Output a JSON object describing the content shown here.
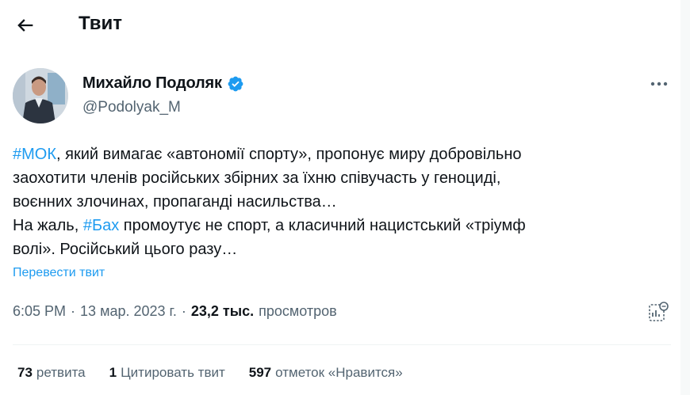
{
  "header": {
    "title": "Твит",
    "back_icon": "arrow-left-icon"
  },
  "author": {
    "name": "Михайло Подоляк",
    "handle": "@Podolyak_M",
    "verified": true,
    "verified_color": "#1d9bf0"
  },
  "tweet": {
    "line1": {
      "tag": "#МОК",
      "text": ", який вимагає «автономії спорту», пропонує миру добровільно"
    },
    "line2": "заохотити членів російських збірних за їхню співучасть у геноциді,",
    "line3": "воєнних злочинах, пропаганді насильства…",
    "line4": {
      "prefix": "На жаль, ",
      "tag": "#Бах",
      "text": " промоутує не спорт, а класичний нацистський «тріумф"
    },
    "line5": "волі». Російський цього разу…"
  },
  "translate_label": "Перевести твит",
  "meta": {
    "time": "6:05 PM",
    "separator": "·",
    "date": "13 мар. 2023 г.",
    "views_count": "23,2 тыс.",
    "views_label": "просмотров"
  },
  "stats": {
    "retweets_count": "73",
    "retweets_label": "ретвита",
    "quotes_count": "1",
    "quotes_label": "Цитировать твит",
    "likes_count": "597",
    "likes_label": "отметок «Нравится»"
  },
  "colors": {
    "accent": "#1d9bf0",
    "secondary_text": "#536471",
    "text": "#0f1419"
  }
}
